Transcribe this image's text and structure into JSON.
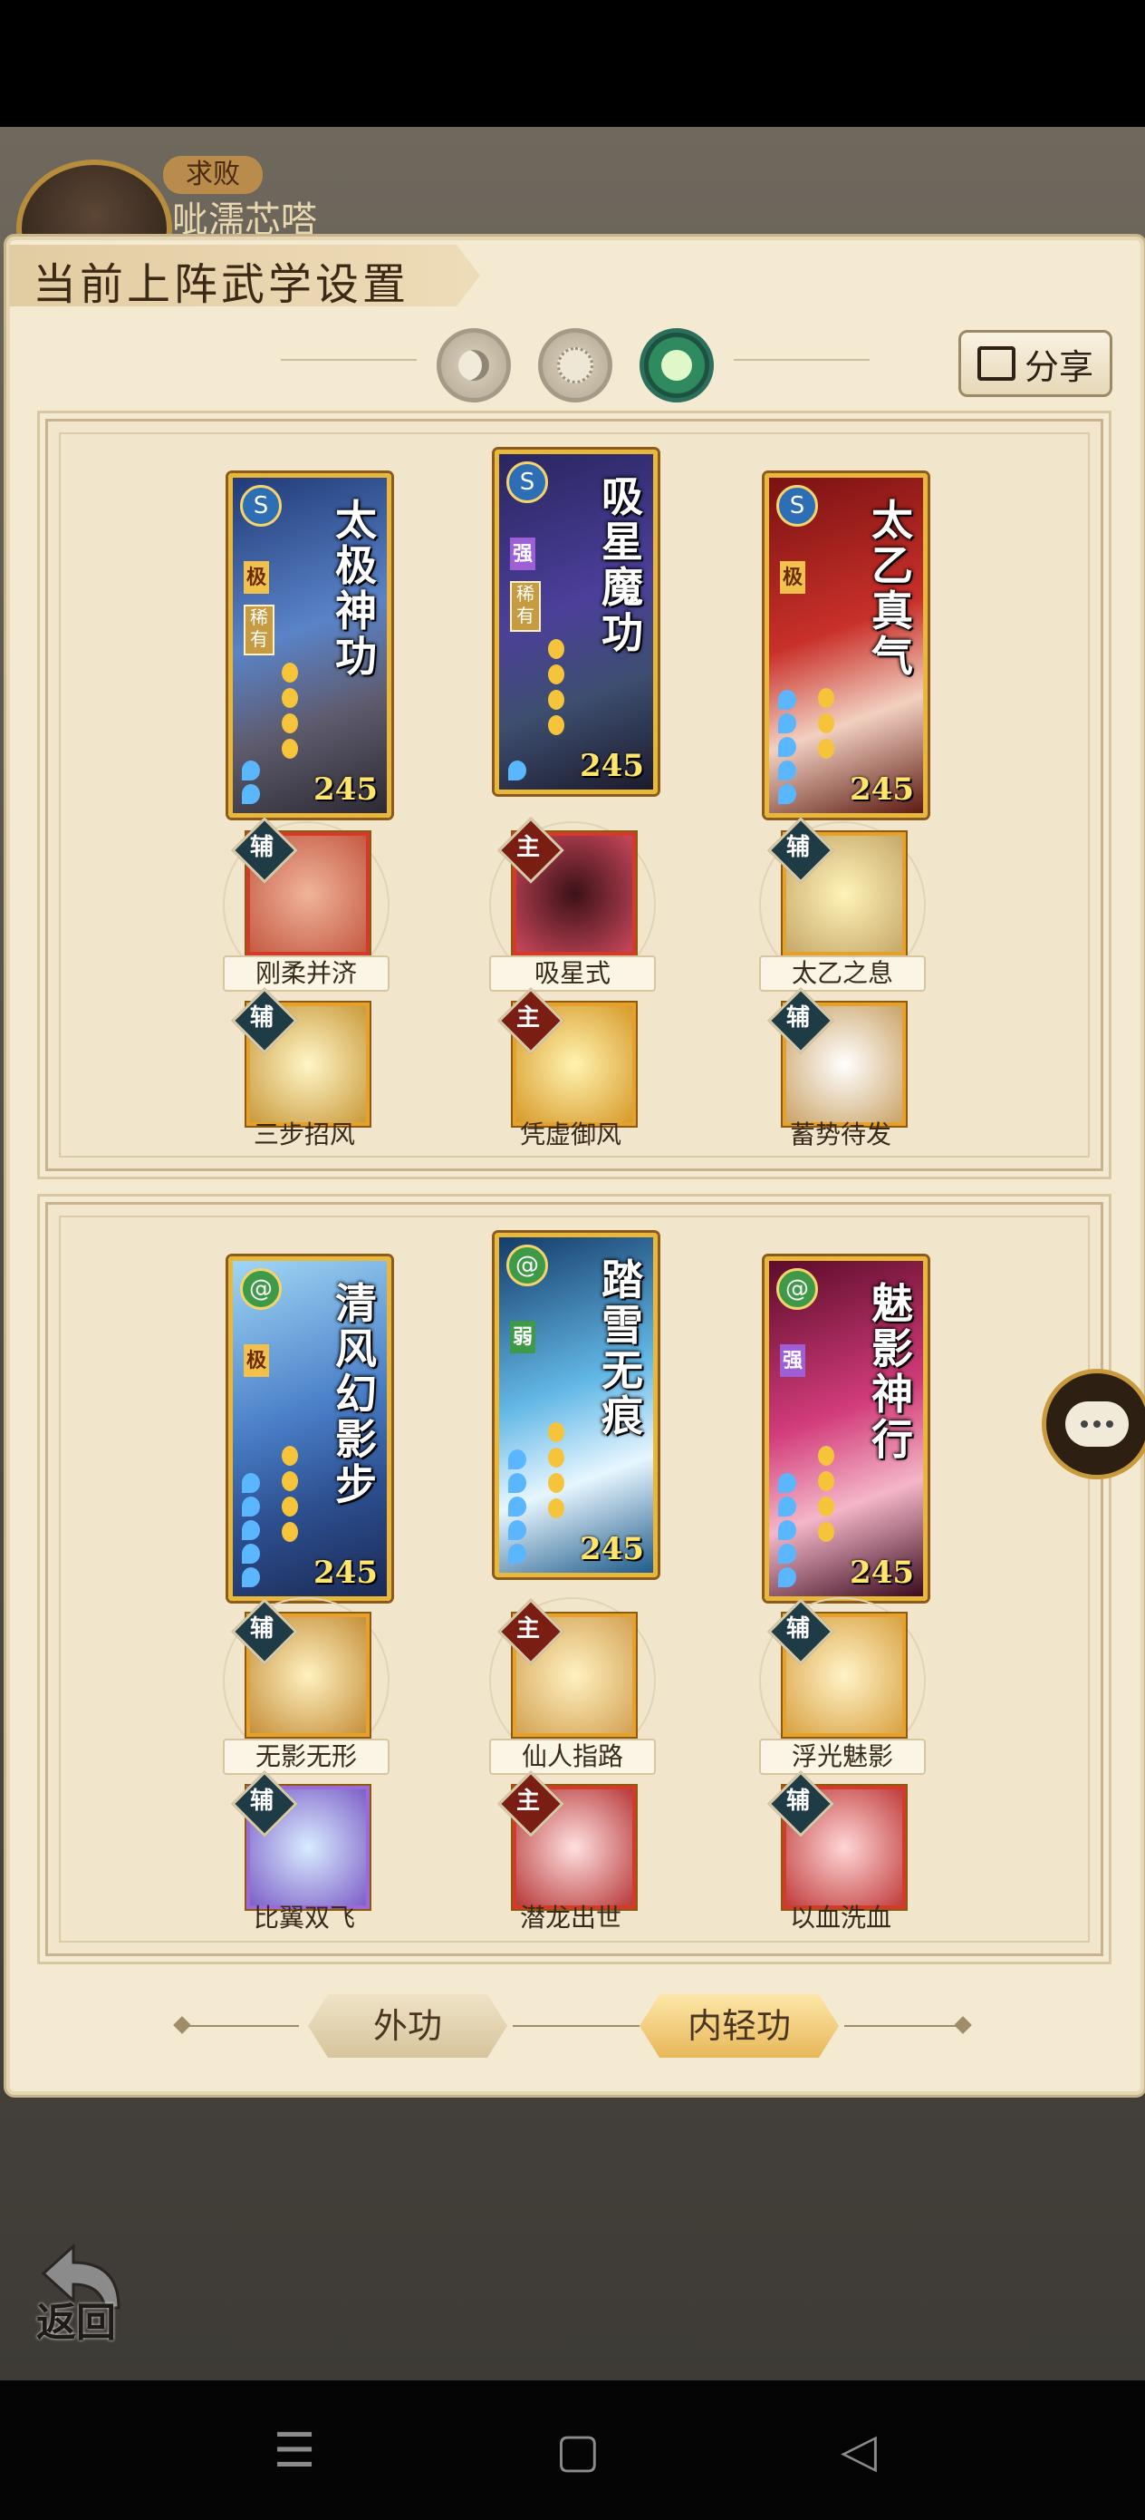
{
  "top": {
    "badge": "求败",
    "name": "呲濡芯嗒"
  },
  "header": {
    "title": "当前上阵武学设置",
    "share_label": "分享"
  },
  "toggles": [
    "moon-mode",
    "sun-mode",
    "jade-mode"
  ],
  "sections": [
    {
      "cards": [
        {
          "name": "太极神功",
          "grade": "极",
          "rare": "稀有",
          "value": "245"
        },
        {
          "name": "吸星魔功",
          "grade": "强",
          "rare": "稀有",
          "value": "245"
        },
        {
          "name": "太乙真气",
          "grade": "极",
          "rare": "",
          "value": "245"
        }
      ],
      "skills_row1": [
        {
          "badge": "辅",
          "label": "刚柔并济"
        },
        {
          "badge": "主",
          "label": "吸星式"
        },
        {
          "badge": "辅",
          "label": "太乙之息"
        }
      ],
      "skills_row2": [
        {
          "badge": "辅",
          "label": "三步招风"
        },
        {
          "badge": "主",
          "label": "凭虚御风"
        },
        {
          "badge": "辅",
          "label": "蓄势待发"
        }
      ]
    },
    {
      "cards": [
        {
          "name": "清风幻影步",
          "grade": "极",
          "rare": "",
          "value": "245"
        },
        {
          "name": "踏雪无痕",
          "grade": "弱",
          "rare": "",
          "value": "245"
        },
        {
          "name": "魅影神行",
          "grade": "强",
          "rare": "",
          "value": "245"
        }
      ],
      "skills_row1": [
        {
          "badge": "辅",
          "label": "无影无形"
        },
        {
          "badge": "主",
          "label": "仙人指路"
        },
        {
          "badge": "辅",
          "label": "浮光魅影"
        }
      ],
      "skills_row2": [
        {
          "badge": "辅",
          "label": "比翼双飞"
        },
        {
          "badge": "主",
          "label": "潜龙出世"
        },
        {
          "badge": "辅",
          "label": "以血洗血"
        }
      ]
    }
  ],
  "tabs": {
    "outer": "外功",
    "inner": "内轻功"
  },
  "back_label": "返回",
  "colors": {
    "accent_gold": "#e9b83b",
    "panel": "#f4ead2",
    "active_toggle": "#2f8b5f"
  }
}
